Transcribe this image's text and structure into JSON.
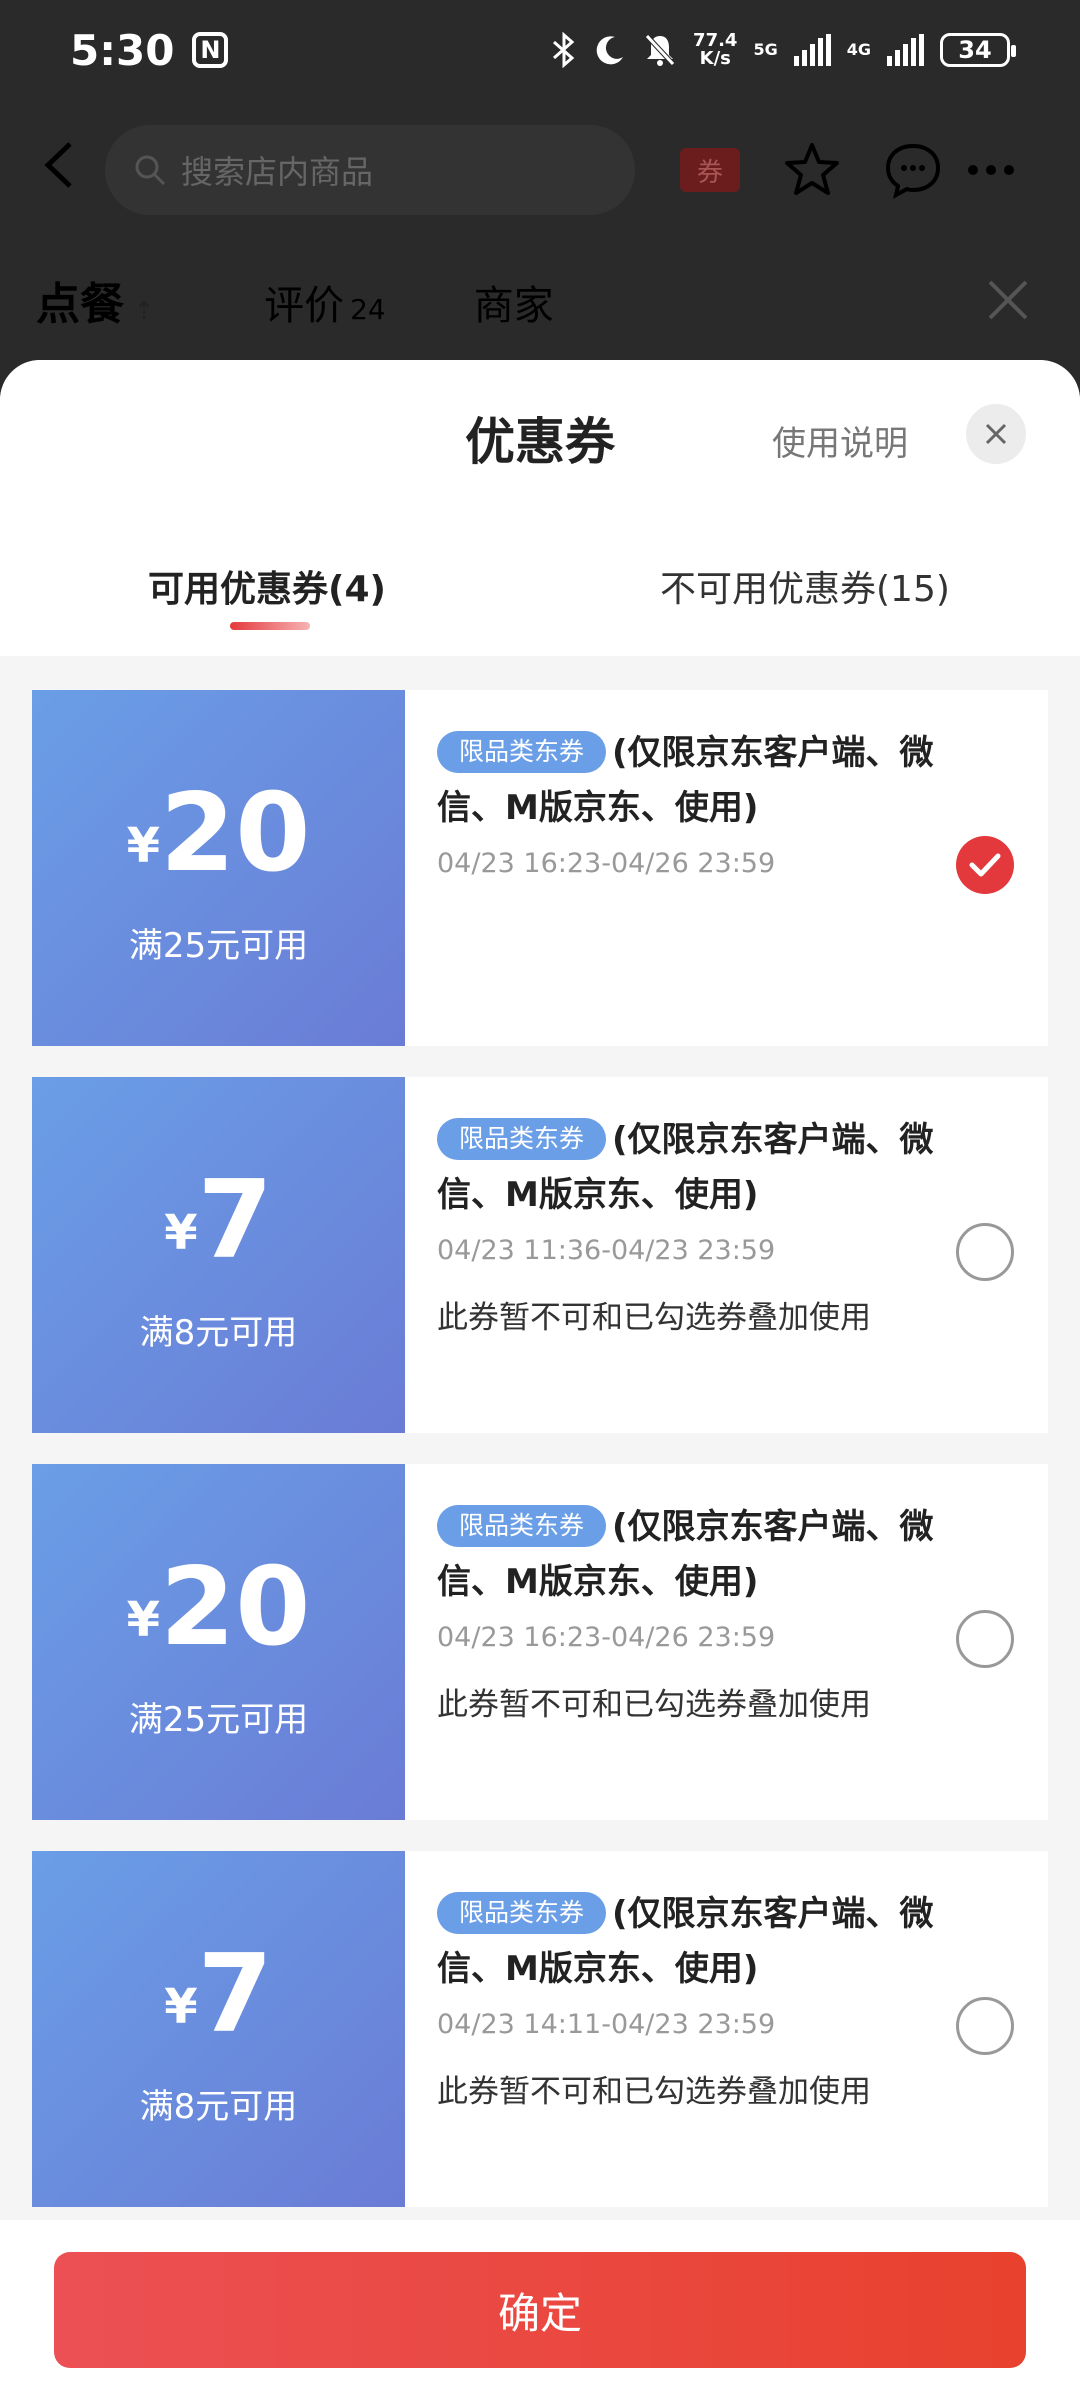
{
  "status_bar": {
    "time": "5:30",
    "nfc": "N",
    "net_speed_value": "77.4",
    "net_speed_unit": "K/s",
    "net_5g": "5G",
    "net_4g": "4G",
    "battery": "34"
  },
  "header": {
    "search_placeholder": "搜索店内商品",
    "coupon_badge": "券"
  },
  "bg_tabs": {
    "order": "点餐",
    "reviews": "评价",
    "reviews_count": "24",
    "merchant": "商家"
  },
  "sheet": {
    "title": "优惠券",
    "usage_link": "使用说明",
    "tab_available": "可用优惠券(4)",
    "tab_unavailable": "不可用优惠券(15)"
  },
  "coupons": [
    {
      "currency": "¥",
      "amount": "20",
      "min_spend": "满25元可用",
      "tag": "限品类东券",
      "line1": "(仅限京东客户端、微",
      "line2": "信、M版京东、使用)",
      "date": "04/23 16:23-04/26 23:59",
      "note": "",
      "selected": true
    },
    {
      "currency": "¥",
      "amount": "7",
      "min_spend": "满8元可用",
      "tag": "限品类东券",
      "line1": "(仅限京东客户端、微",
      "line2": "信、M版京东、使用)",
      "date": "04/23 11:36-04/23 23:59",
      "note": "此券暂不可和已勾选券叠加使用",
      "selected": false
    },
    {
      "currency": "¥",
      "amount": "20",
      "min_spend": "满25元可用",
      "tag": "限品类东券",
      "line1": "(仅限京东客户端、微",
      "line2": "信、M版京东、使用)",
      "date": "04/23 16:23-04/26 23:59",
      "note": "此券暂不可和已勾选券叠加使用",
      "selected": false
    },
    {
      "currency": "¥",
      "amount": "7",
      "min_spend": "满8元可用",
      "tag": "限品类东券",
      "line1": "(仅限京东客户端、微",
      "line2": "信、M版京东、使用)",
      "date": "04/23 14:11-04/23 23:59",
      "note": "此券暂不可和已勾选券叠加使用",
      "selected": false
    }
  ],
  "footer": {
    "confirm": "确定"
  },
  "icons": {
    "back": "back-arrow-icon",
    "search": "search-icon",
    "star": "star-icon",
    "message": "chat-icon",
    "more": "more-icon",
    "close": "close-icon",
    "check": "check-icon"
  },
  "colors": {
    "accent": "#e4393c",
    "coupon_blue": "#6a9ee6",
    "coupon_indigo": "#6a7cd6"
  }
}
